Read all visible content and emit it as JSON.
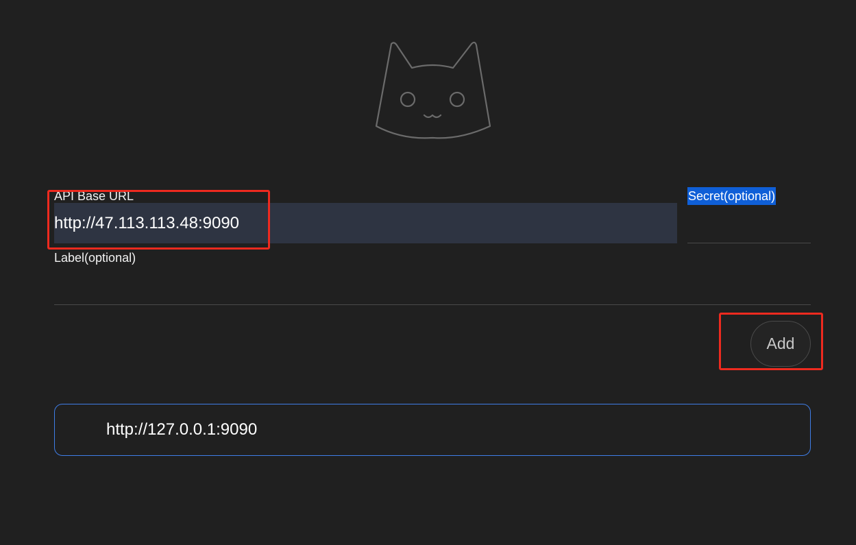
{
  "form": {
    "api_base_url_label": "API Base URL",
    "api_base_url_value": "http://47.113.113.48:9090",
    "secret_label": "Secret(optional)",
    "secret_value": "",
    "label_label": "Label(optional)",
    "label_value": ""
  },
  "actions": {
    "add_label": "Add"
  },
  "backends": [
    {
      "url": "http://127.0.0.1:9090"
    }
  ],
  "colors": {
    "background": "#202020",
    "input_highlight": "#2e3442",
    "selection": "#0f5fd7",
    "annotation_box": "#ee2a1f",
    "item_border": "#3f7ee8"
  },
  "icons": {
    "logo": "cat-logo-icon"
  }
}
